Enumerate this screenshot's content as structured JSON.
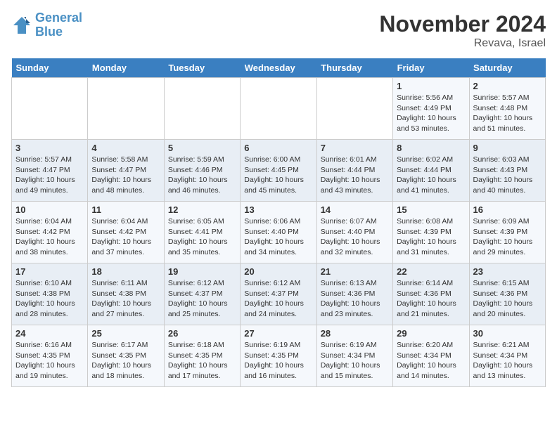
{
  "logo": {
    "line1": "General",
    "line2": "Blue"
  },
  "title": "November 2024",
  "location": "Revava, Israel",
  "days_header": [
    "Sunday",
    "Monday",
    "Tuesday",
    "Wednesday",
    "Thursday",
    "Friday",
    "Saturday"
  ],
  "weeks": [
    [
      {
        "day": "",
        "info": ""
      },
      {
        "day": "",
        "info": ""
      },
      {
        "day": "",
        "info": ""
      },
      {
        "day": "",
        "info": ""
      },
      {
        "day": "",
        "info": ""
      },
      {
        "day": "1",
        "info": "Sunrise: 5:56 AM\nSunset: 4:49 PM\nDaylight: 10 hours\nand 53 minutes."
      },
      {
        "day": "2",
        "info": "Sunrise: 5:57 AM\nSunset: 4:48 PM\nDaylight: 10 hours\nand 51 minutes."
      }
    ],
    [
      {
        "day": "3",
        "info": "Sunrise: 5:57 AM\nSunset: 4:47 PM\nDaylight: 10 hours\nand 49 minutes."
      },
      {
        "day": "4",
        "info": "Sunrise: 5:58 AM\nSunset: 4:47 PM\nDaylight: 10 hours\nand 48 minutes."
      },
      {
        "day": "5",
        "info": "Sunrise: 5:59 AM\nSunset: 4:46 PM\nDaylight: 10 hours\nand 46 minutes."
      },
      {
        "day": "6",
        "info": "Sunrise: 6:00 AM\nSunset: 4:45 PM\nDaylight: 10 hours\nand 45 minutes."
      },
      {
        "day": "7",
        "info": "Sunrise: 6:01 AM\nSunset: 4:44 PM\nDaylight: 10 hours\nand 43 minutes."
      },
      {
        "day": "8",
        "info": "Sunrise: 6:02 AM\nSunset: 4:44 PM\nDaylight: 10 hours\nand 41 minutes."
      },
      {
        "day": "9",
        "info": "Sunrise: 6:03 AM\nSunset: 4:43 PM\nDaylight: 10 hours\nand 40 minutes."
      }
    ],
    [
      {
        "day": "10",
        "info": "Sunrise: 6:04 AM\nSunset: 4:42 PM\nDaylight: 10 hours\nand 38 minutes."
      },
      {
        "day": "11",
        "info": "Sunrise: 6:04 AM\nSunset: 4:42 PM\nDaylight: 10 hours\nand 37 minutes."
      },
      {
        "day": "12",
        "info": "Sunrise: 6:05 AM\nSunset: 4:41 PM\nDaylight: 10 hours\nand 35 minutes."
      },
      {
        "day": "13",
        "info": "Sunrise: 6:06 AM\nSunset: 4:40 PM\nDaylight: 10 hours\nand 34 minutes."
      },
      {
        "day": "14",
        "info": "Sunrise: 6:07 AM\nSunset: 4:40 PM\nDaylight: 10 hours\nand 32 minutes."
      },
      {
        "day": "15",
        "info": "Sunrise: 6:08 AM\nSunset: 4:39 PM\nDaylight: 10 hours\nand 31 minutes."
      },
      {
        "day": "16",
        "info": "Sunrise: 6:09 AM\nSunset: 4:39 PM\nDaylight: 10 hours\nand 29 minutes."
      }
    ],
    [
      {
        "day": "17",
        "info": "Sunrise: 6:10 AM\nSunset: 4:38 PM\nDaylight: 10 hours\nand 28 minutes."
      },
      {
        "day": "18",
        "info": "Sunrise: 6:11 AM\nSunset: 4:38 PM\nDaylight: 10 hours\nand 27 minutes."
      },
      {
        "day": "19",
        "info": "Sunrise: 6:12 AM\nSunset: 4:37 PM\nDaylight: 10 hours\nand 25 minutes."
      },
      {
        "day": "20",
        "info": "Sunrise: 6:12 AM\nSunset: 4:37 PM\nDaylight: 10 hours\nand 24 minutes."
      },
      {
        "day": "21",
        "info": "Sunrise: 6:13 AM\nSunset: 4:36 PM\nDaylight: 10 hours\nand 23 minutes."
      },
      {
        "day": "22",
        "info": "Sunrise: 6:14 AM\nSunset: 4:36 PM\nDaylight: 10 hours\nand 21 minutes."
      },
      {
        "day": "23",
        "info": "Sunrise: 6:15 AM\nSunset: 4:36 PM\nDaylight: 10 hours\nand 20 minutes."
      }
    ],
    [
      {
        "day": "24",
        "info": "Sunrise: 6:16 AM\nSunset: 4:35 PM\nDaylight: 10 hours\nand 19 minutes."
      },
      {
        "day": "25",
        "info": "Sunrise: 6:17 AM\nSunset: 4:35 PM\nDaylight: 10 hours\nand 18 minutes."
      },
      {
        "day": "26",
        "info": "Sunrise: 6:18 AM\nSunset: 4:35 PM\nDaylight: 10 hours\nand 17 minutes."
      },
      {
        "day": "27",
        "info": "Sunrise: 6:19 AM\nSunset: 4:35 PM\nDaylight: 10 hours\nand 16 minutes."
      },
      {
        "day": "28",
        "info": "Sunrise: 6:19 AM\nSunset: 4:34 PM\nDaylight: 10 hours\nand 15 minutes."
      },
      {
        "day": "29",
        "info": "Sunrise: 6:20 AM\nSunset: 4:34 PM\nDaylight: 10 hours\nand 14 minutes."
      },
      {
        "day": "30",
        "info": "Sunrise: 6:21 AM\nSunset: 4:34 PM\nDaylight: 10 hours\nand 13 minutes."
      }
    ]
  ]
}
